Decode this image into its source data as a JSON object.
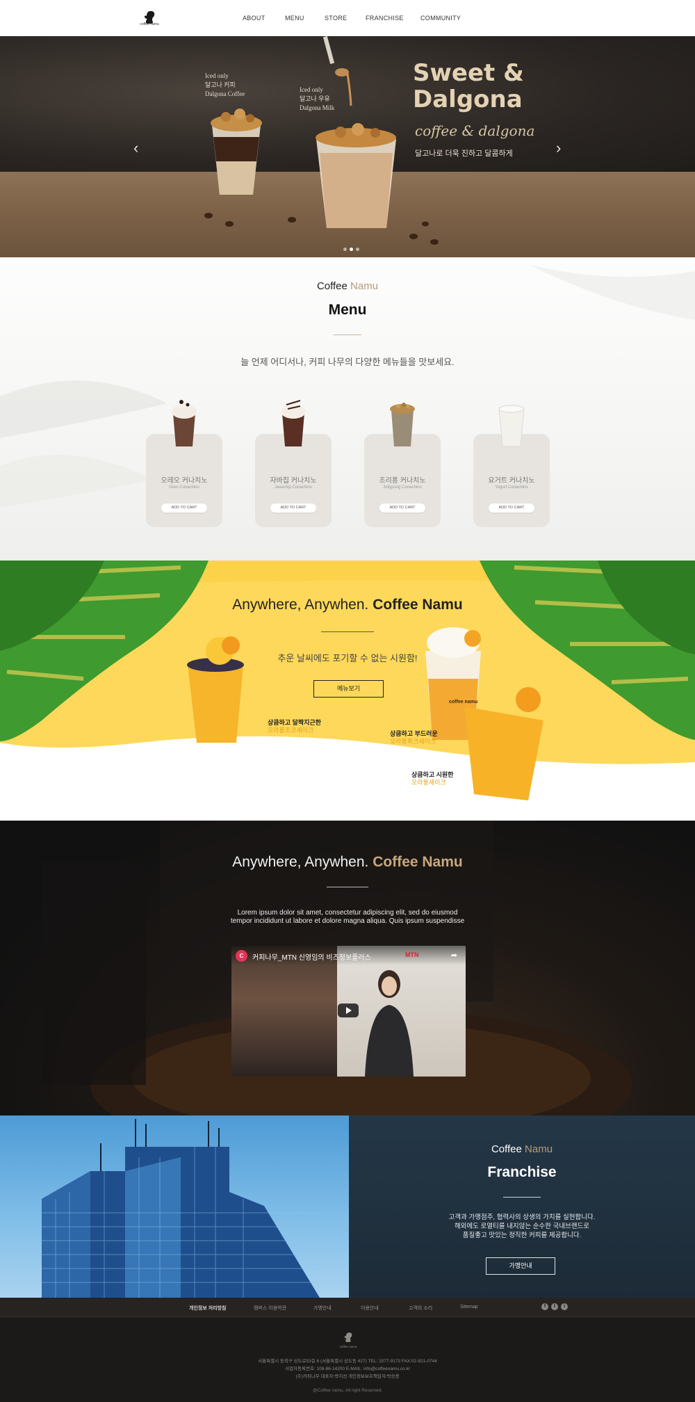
{
  "header": {
    "logo_text": "coffee namu",
    "nav": [
      "ABOUT",
      "MENU",
      "STORE",
      "FRANCHISE",
      "COMMUNITY"
    ]
  },
  "hero": {
    "title_line1": "Sweet &",
    "title_line2": "Dalgona",
    "subtitle": "coffee & dalgona",
    "tagline": "달고나로 더욱 진하고 달콤하게",
    "cup1": [
      "Iced only",
      "달고나 커피",
      "Dalgona Coffee"
    ],
    "cup2": [
      "Iced only",
      "달고나 우유",
      "Dalgona Milk"
    ],
    "prev_icon": "chevron-left-icon",
    "next_icon": "chevron-right-icon",
    "slides": 3,
    "active_slide": 2
  },
  "menu": {
    "brand_a": "Coffee",
    "brand_b": "Namu",
    "title": "Menu",
    "description": "늘 언제 어디서나, 커피 나무의 다양한 메뉴들을 맛보세요.",
    "cards": [
      {
        "name": "오레오 커나치노",
        "en": "Oreo Conachino",
        "button": "ADD TO CART"
      },
      {
        "name": "자바칩 커나치노",
        "en": "Javachip Conachino",
        "button": "ADD TO CART"
      },
      {
        "name": "조리퐁 커나치노",
        "en": "Jollypong Conachino",
        "button": "ADD TO CART"
      },
      {
        "name": "요거트 커나치노",
        "en": "Yogurt Conachino",
        "button": "ADD TO CART"
      }
    ]
  },
  "promo": {
    "title_a": "Anywhere, Anywhen.",
    "title_b": "Coffee Namu",
    "description": "추운 날씨에도 포기할 수 없는 시원함!",
    "button": "메뉴보기",
    "cup_brand": "coffee namu",
    "tags": [
      {
        "top": "상큼하고 달짝지근한",
        "bottom": "오라봉초코셰이크"
      },
      {
        "top": "상큼하고 부드러운",
        "bottom": "오라봉휘크셰이크"
      },
      {
        "top": "상큼하고 시원한",
        "bottom": "오라봉셰이크"
      }
    ]
  },
  "video": {
    "title_a": "Anywhere, Anywhen.",
    "title_b": "Coffee Namu",
    "description_line1": "Lorem ipsum dolor sit amet, consectetur adipiscing elit, sed do eiusmod",
    "description_line2": "tempor incididunt ut labore et dolore magna aliqua. Quis ipsum suspendisse",
    "player_channel": "C",
    "player_title": "커피나무_MTN 신영임의 비즈정보플러스",
    "player_mark": "MTN"
  },
  "franchise": {
    "brand_a": "Coffee",
    "brand_b": "Namu",
    "title": "Franchise",
    "desc_line1": "고객과 가맹점주, 협력사의 상생의 가치를 실현합니다.",
    "desc_line2": "해외에도 로열티를 내지않는 순수한 국내브랜드로",
    "desc_line3": "품질좋고 맛있는 정직한 커피를 제공합니다.",
    "button": "가맹안내"
  },
  "footer": {
    "links": [
      "개인정보 처리방침",
      "멤버스 이용약관",
      "가맹안내",
      "이용안내",
      "고객의 소리",
      "Sitemap"
    ],
    "sns": [
      "f",
      "t",
      "i"
    ],
    "logo_text": "coffee namu",
    "info_line1": "서울특별시 동작구 상도로53길 6 (서울특별시 상도동 427)    TEL: 1577-9173    FAX:02-821-0744",
    "info_line2": "사업자등록번호: 108-86-14200    E-MAIL: info@coffeenamu.co.kr",
    "info_line3": "(주)커피나무 대표자:박지선    개인정보보호책임자:박승용",
    "copyright": "@Coffee namu. All right Reserved."
  },
  "colors": {
    "brand_gold": "#b69b7b",
    "promo_yellow": "#fdd85a",
    "franchise_navy": "#243747",
    "footer_dark": "#1c1a19"
  }
}
